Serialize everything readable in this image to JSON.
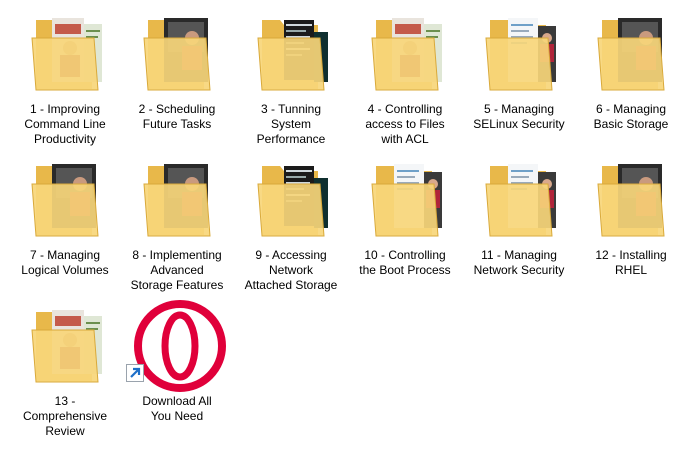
{
  "folders": [
    {
      "label": "1 - Improving\nCommand Line\nProductivity",
      "variant": "screen"
    },
    {
      "label": "2 - Scheduling\nFuture Tasks",
      "variant": "dark"
    },
    {
      "label": "3 - Tunning\nSystem\nPerformance",
      "variant": "terminal"
    },
    {
      "label": "4 - Controlling\naccess to Files\nwith ACL",
      "variant": "screen"
    },
    {
      "label": "5 - Managing\nSELinux Security",
      "variant": "doc"
    },
    {
      "label": "6 - Managing\nBasic Storage",
      "variant": "dark"
    },
    {
      "label": "7 - Managing\nLogical Volumes",
      "variant": "dark"
    },
    {
      "label": "8 - Implementing\nAdvanced\nStorage Features",
      "variant": "dark"
    },
    {
      "label": "9 - Accessing\nNetwork\nAttached Storage",
      "variant": "terminal"
    },
    {
      "label": "10 - Controlling\nthe Boot Process",
      "variant": "doc"
    },
    {
      "label": "11 - Managing\nNetwork Security",
      "variant": "doc"
    },
    {
      "label": "12 - Installing\nRHEL",
      "variant": "dark"
    },
    {
      "label": "13 -\nComprehensive\nReview",
      "variant": "screen"
    }
  ],
  "shortcut": {
    "label": "Download All\nYou Need",
    "icon": "opera-gx-icon",
    "color": "#e0003a"
  }
}
